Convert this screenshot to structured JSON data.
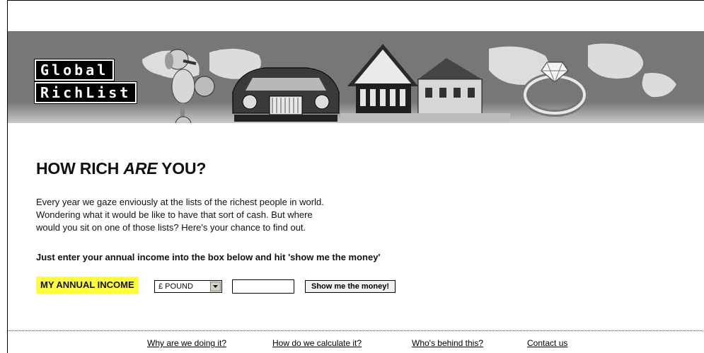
{
  "banner": {
    "logo_line1": "Global",
    "logo_line2": "RichList",
    "icons": [
      "poodle-image",
      "rolls-royce-car-image",
      "mansion-house-image",
      "diamond-ring-image",
      "world-map-background"
    ]
  },
  "main": {
    "heading_prefix": "HOW RICH ",
    "heading_emph": "ARE",
    "heading_suffix": " YOU?",
    "intro_line1": "Every year we gaze enviously at the lists of the richest people in world.",
    "intro_line2": "Wondering what it would be like to have that sort of cash. But where",
    "intro_line3": "would you sit on one of those lists? Here's your chance to find out.",
    "instruction": "Just enter your annual income into the box below and hit 'show me the money'"
  },
  "form": {
    "income_label": "MY ANNUAL INCOME",
    "currency_selected": "£ POUND",
    "income_value": "",
    "submit_label": "Show me the money!"
  },
  "footer": {
    "links": [
      "Why are we doing it?",
      "How do we calculate it?",
      "Who's behind this?",
      "Contact us"
    ]
  },
  "colors": {
    "highlight": "#ffff33",
    "text": "#111111",
    "banner_dots": "#555555"
  }
}
